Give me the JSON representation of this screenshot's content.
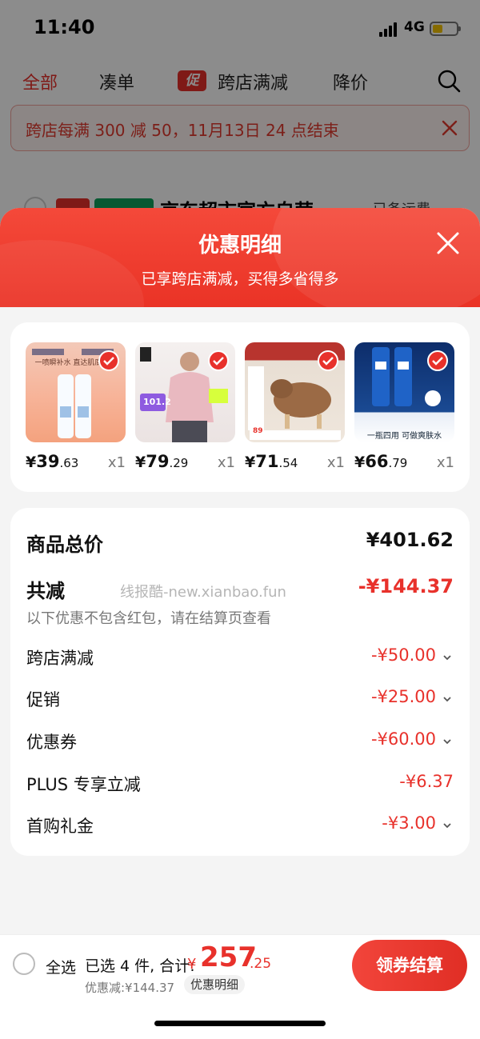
{
  "status_bar": {
    "time": "11:40",
    "network": "4G"
  },
  "tabs": [
    {
      "label": "全部"
    },
    {
      "label": "凑单"
    },
    {
      "promo_badge": "促",
      "label": "跨店满减"
    },
    {
      "label": "降价"
    }
  ],
  "notice": {
    "text": "跨店每满 300 减 50，11月13日 24 点结束"
  },
  "peek": {
    "shop": "京东超市官方自营",
    "right": "已备运费"
  },
  "sheet": {
    "title": "优惠明细",
    "subtitle": "已享跨店满减，买得多省得多"
  },
  "products": [
    {
      "currency": "¥",
      "price_int": "39",
      "price_dec": ".63",
      "qty": "x1",
      "img_text": "一喷瞬补水 直达肌底锁水"
    },
    {
      "currency": "¥",
      "price_int": "79",
      "price_dec": ".29",
      "qty": "x1",
      "img_text": "101.2"
    },
    {
      "currency": "¥",
      "price_int": "71",
      "price_dec": ".54",
      "qty": "x1",
      "img_text": "89"
    },
    {
      "currency": "¥",
      "price_int": "66",
      "price_dec": ".79",
      "qty": "x1",
      "img_text": "一瓶四用 可做爽肤水"
    }
  ],
  "summary": {
    "total_label": "商品总价",
    "total_value": "¥401.62",
    "reduce_label": "共减",
    "reduce_value": "-¥144.37",
    "note": "以下优惠不包含红包，请在结算页查看",
    "items": [
      {
        "label": "跨店满减",
        "value": "-¥50.00",
        "expandable": true
      },
      {
        "label": "促销",
        "value": "-¥25.00",
        "expandable": true
      },
      {
        "label": "优惠券",
        "value": "-¥60.00",
        "expandable": true
      },
      {
        "label": "PLUS 专享立减",
        "value": "-¥6.37",
        "expandable": false
      },
      {
        "label": "首购礼金",
        "value": "-¥3.00",
        "expandable": true
      }
    ]
  },
  "watermark": "线报酷-new.xianbao.fun",
  "bottom_bar": {
    "select_all": "全选",
    "selected": "已选 4 件, 合计:",
    "currency": "¥",
    "total_int": "257",
    "total_dec": ".25",
    "discount": "优惠减:¥144.37",
    "detail_btn": "优惠明细",
    "checkout": "领券结算"
  },
  "colors": {
    "accent": "#e8312b",
    "sheet_header": "#ef3d2f"
  }
}
